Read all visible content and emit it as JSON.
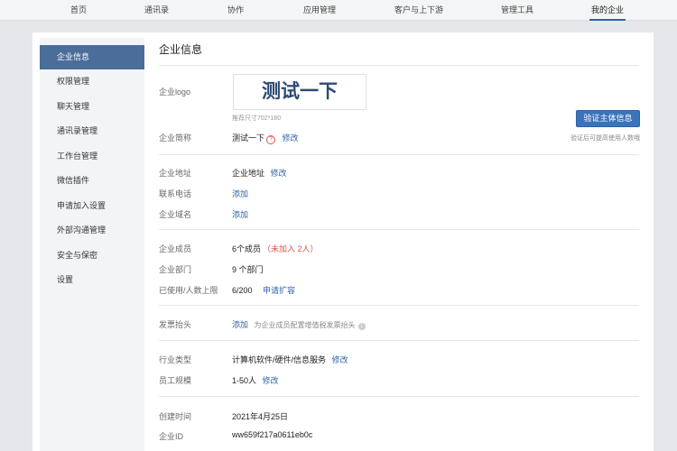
{
  "topnav": {
    "items": [
      "首页",
      "通讯录",
      "协作",
      "应用管理",
      "客户与上下游",
      "管理工具",
      "我的企业"
    ],
    "active": "我的企业"
  },
  "sidebar": {
    "items": [
      "企业信息",
      "权限管理",
      "聊天管理",
      "通讯录管理",
      "工作台管理",
      "微信插件",
      "申请加入设置",
      "外部沟通管理",
      "安全与保密",
      "设置"
    ],
    "active": "企业信息"
  },
  "main": {
    "title": "企业信息",
    "logo": {
      "label": "企业logo",
      "image_text": "测试一下",
      "hint": "推荐尺寸702*180"
    },
    "verify": {
      "button": "验证主体信息",
      "hint": "验证后可提高使用人数哦"
    },
    "short_name": {
      "label": "企业简称",
      "value": "测试一下",
      "help_icon": "?",
      "edit": "修改"
    },
    "address": {
      "label": "企业地址",
      "value": "企业地址",
      "edit": "修改"
    },
    "phone": {
      "label": "联系电话",
      "action": "添加"
    },
    "domain": {
      "label": "企业域名",
      "action": "添加"
    },
    "members": {
      "label": "企业成员",
      "value": "6个成员",
      "pending": "（未加入 2人）"
    },
    "departments": {
      "label": "企业部门",
      "value": "9 个部门"
    },
    "usage": {
      "label": "已使用/人数上限",
      "value": "6/200",
      "action": "申请扩容"
    },
    "invoice": {
      "label": "发票抬头",
      "action": "添加",
      "hint": "为企业成员配置增值税发票抬头",
      "info_icon": "i"
    },
    "industry": {
      "label": "行业类型",
      "value": "计算机软件/硬件/信息服务",
      "edit": "修改"
    },
    "scale": {
      "label": "员工规模",
      "value": "1-50人",
      "edit": "修改"
    },
    "created": {
      "label": "创建时间",
      "value": "2021年4月25日"
    },
    "corp_id": {
      "label": "企业ID",
      "value": "ww659f217a0611eb0c"
    }
  },
  "colors": {
    "accent": "#2e64a8",
    "sidebar_active": "#4b6d9a",
    "button": "#3b73b9",
    "warning": "#d9534f"
  }
}
